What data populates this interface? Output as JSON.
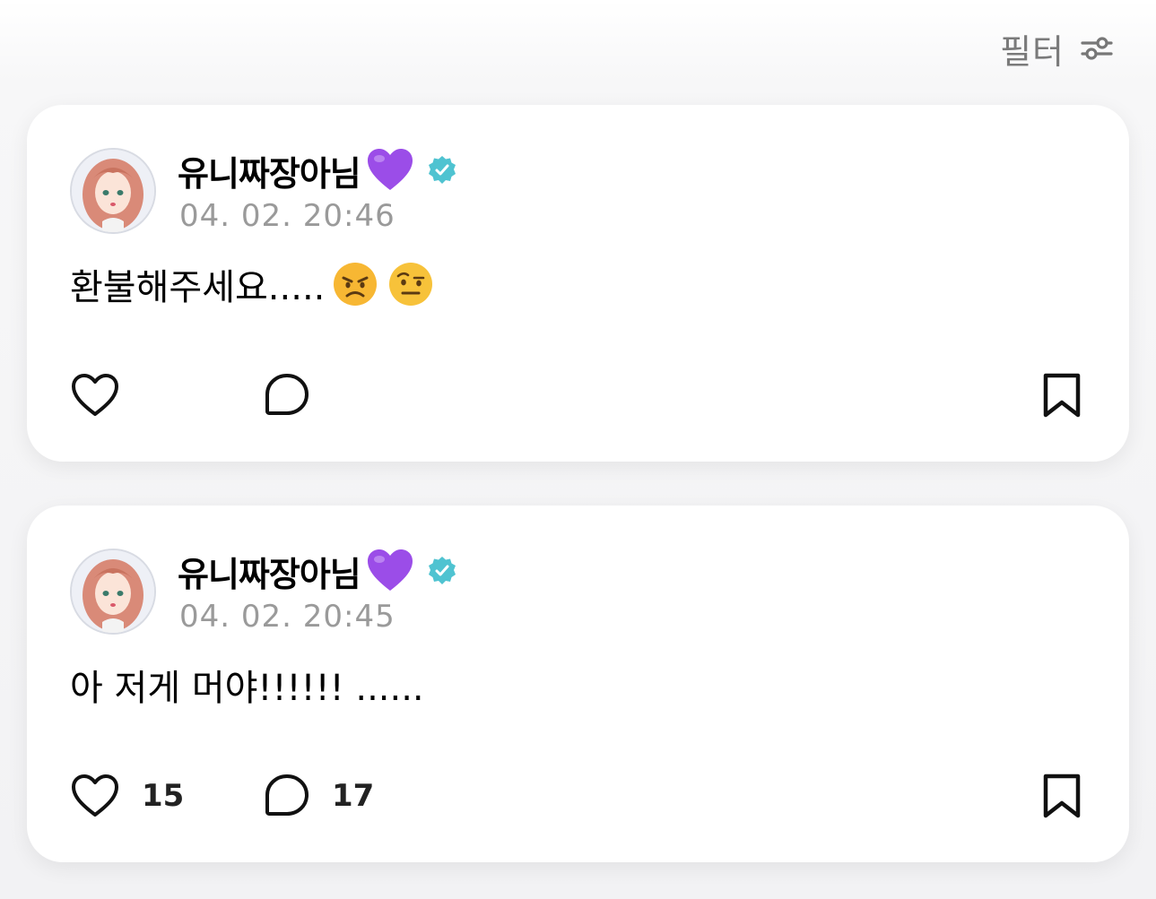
{
  "toolbar": {
    "filter_label": "필터",
    "filter_icon": "sliders-icon"
  },
  "posts": [
    {
      "author": "유니짜장아님",
      "author_emoji": "purple-heart-emoji",
      "verified_icon": "verified-badge-icon",
      "verified_color": "#4fc3d1",
      "timestamp": "04. 02. 20:46",
      "text": "환불해주세요.....",
      "emojis": [
        "angry-face-emoji",
        "face-with-raised-eyebrow-emoji"
      ],
      "likes": "",
      "comments": ""
    },
    {
      "author": "유니짜장아님",
      "author_emoji": "purple-heart-emoji",
      "verified_icon": "verified-badge-icon",
      "verified_color": "#4fc3d1",
      "timestamp": "04. 02. 20:45",
      "text": "아 저게 머야!!!!!! ......",
      "emojis": [],
      "likes": "15",
      "comments": "17"
    }
  ]
}
